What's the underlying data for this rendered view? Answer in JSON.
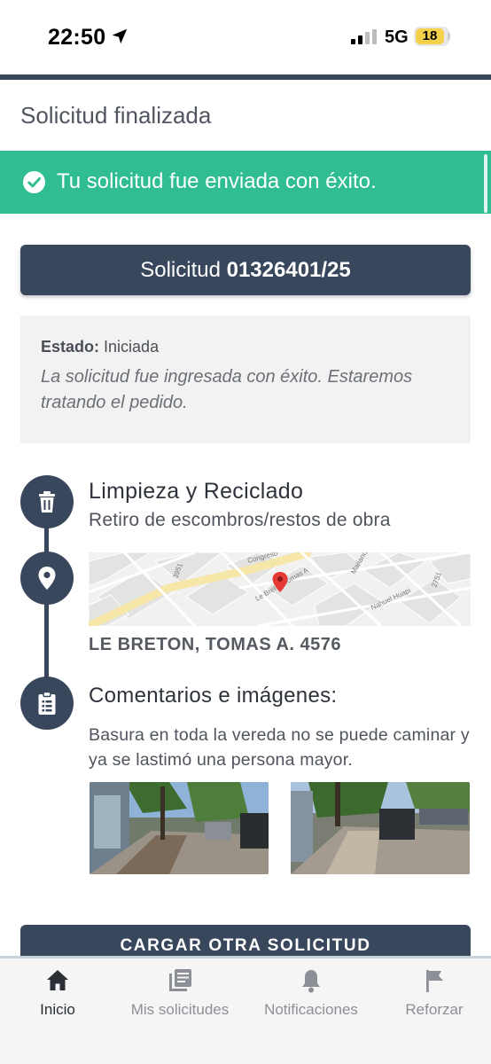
{
  "status_bar": {
    "time": "22:50",
    "network": "5G",
    "battery": "18"
  },
  "header": {
    "title": "Solicitud finalizada"
  },
  "banner": {
    "message": "Tu solicitud fue enviada con éxito."
  },
  "request": {
    "label": "Solicitud",
    "number": "01326401/25"
  },
  "status": {
    "label": "Estado:",
    "value": "Iniciada",
    "message": "La solicitud fue ingresada con éxito. Estaremos tratando el pedido."
  },
  "category": {
    "title": "Limpieza y Reciclado",
    "subtitle": "Retiro de escombros/restos de obra"
  },
  "location": {
    "address": "LE BRETON, TOMAS A. 4576",
    "map_labels": [
      "Congreso",
      "Le Breton Tomas A",
      "Mariano Grand",
      "Nahuel Huapi",
      "3951",
      "2751"
    ]
  },
  "comments": {
    "title": "Comentarios e imágenes:",
    "text": "Basura en toda la vereda no se puede caminar y ya se lastimó una persona mayor."
  },
  "cta": {
    "label": "CARGAR OTRA SOLICITUD"
  },
  "nav": {
    "items": [
      {
        "label": "Inicio",
        "icon": "home-icon",
        "active": true
      },
      {
        "label": "Mis solicitudes",
        "icon": "documents-icon",
        "active": false
      },
      {
        "label": "Notificaciones",
        "icon": "bell-icon",
        "active": false
      },
      {
        "label": "Reforzar",
        "icon": "flag-icon",
        "active": false
      }
    ]
  },
  "colors": {
    "primary": "#39475c",
    "success": "#2fbd91",
    "nav_inactive": "#8c9096"
  }
}
